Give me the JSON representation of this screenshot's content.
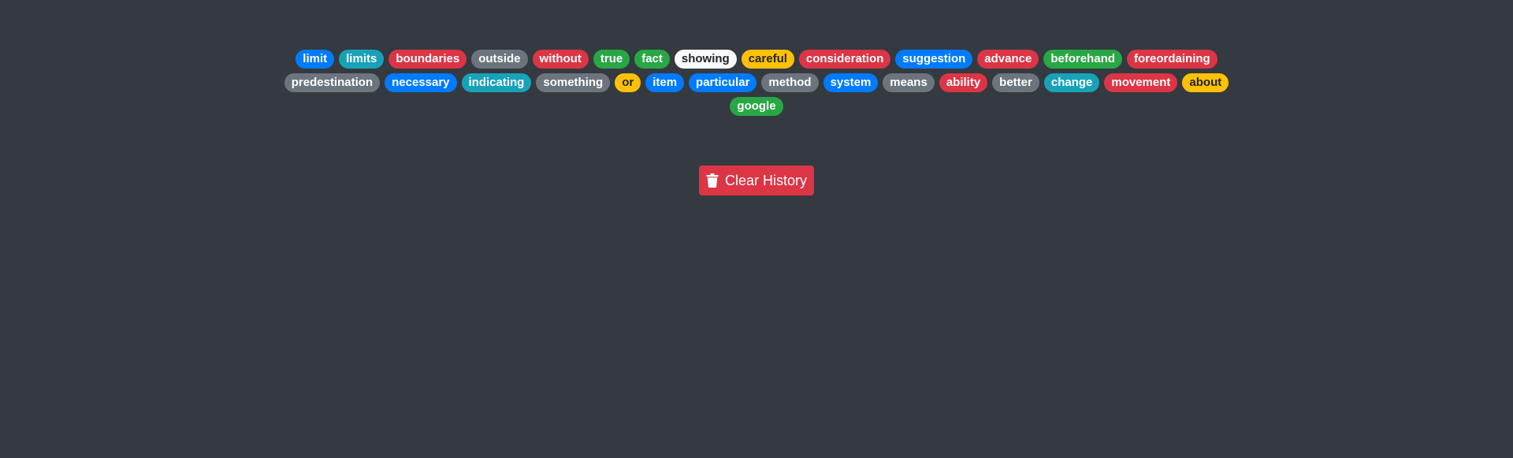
{
  "tags": [
    {
      "label": "limit",
      "variant": "primary"
    },
    {
      "label": "limits",
      "variant": "info"
    },
    {
      "label": "boundaries",
      "variant": "danger"
    },
    {
      "label": "outside",
      "variant": "secondary"
    },
    {
      "label": "without",
      "variant": "danger"
    },
    {
      "label": "true",
      "variant": "success"
    },
    {
      "label": "fact",
      "variant": "success"
    },
    {
      "label": "showing",
      "variant": "light"
    },
    {
      "label": "careful",
      "variant": "warning"
    },
    {
      "label": "consideration",
      "variant": "danger"
    },
    {
      "label": "suggestion",
      "variant": "primary"
    },
    {
      "label": "advance",
      "variant": "danger"
    },
    {
      "label": "beforehand",
      "variant": "success"
    },
    {
      "label": "foreordaining",
      "variant": "danger"
    },
    {
      "label": "predestination",
      "variant": "secondary"
    },
    {
      "label": "necessary",
      "variant": "primary"
    },
    {
      "label": "indicating",
      "variant": "info"
    },
    {
      "label": "something",
      "variant": "secondary"
    },
    {
      "label": "or",
      "variant": "warning"
    },
    {
      "label": "item",
      "variant": "primary"
    },
    {
      "label": "particular",
      "variant": "primary"
    },
    {
      "label": "method",
      "variant": "secondary"
    },
    {
      "label": "system",
      "variant": "primary"
    },
    {
      "label": "means",
      "variant": "secondary"
    },
    {
      "label": "ability",
      "variant": "danger"
    },
    {
      "label": "better",
      "variant": "secondary"
    },
    {
      "label": "change",
      "variant": "info"
    },
    {
      "label": "movement",
      "variant": "danger"
    },
    {
      "label": "about",
      "variant": "warning"
    },
    {
      "label": "google",
      "variant": "success"
    }
  ],
  "clear_button": {
    "label": "Clear History",
    "icon": "trash-icon",
    "color": "#dc3545"
  },
  "colors": {
    "background": "#343a40",
    "primary": "#007bff",
    "info": "#17a2b8",
    "danger": "#dc3545",
    "secondary": "#6c757d",
    "success": "#28a745",
    "light": "#f8f9fa",
    "warning": "#ffc107"
  }
}
